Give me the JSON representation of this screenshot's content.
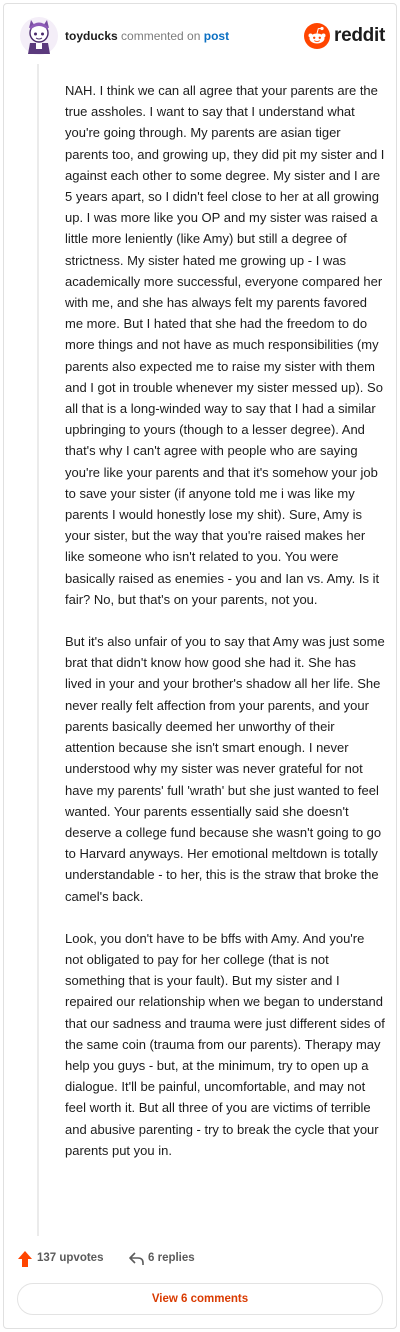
{
  "header": {
    "username": "toyducks",
    "action": "commented on",
    "target": "post",
    "brand": "reddit"
  },
  "icons": {
    "avatar": "avatar-icon",
    "logo": "reddit-logo-icon",
    "upvote": "upvote-arrow-icon",
    "reply": "reply-arrow-icon"
  },
  "colors": {
    "upvote": "#ff4500",
    "link": "#0a6fc2",
    "view_button_text": "#d93a00"
  },
  "comment": {
    "paragraphs": [
      "NAH. I think we can all agree that your parents are the true assholes. I want to say that I understand what you're going through. My parents are asian tiger parents too, and growing up, they did pit my sister and I against each other to some degree. My sister and I are 5 years apart, so I didn't feel close to her at all growing up. I was more like you OP and my sister was raised a little more leniently (like Amy) but still a degree of strictness. My sister hated me growing up - I was academically more successful, everyone compared her with me, and she has always felt my parents favored me more. But I hated that she had the freedom to do more things and not have as much responsibilities (my parents also expected me to raise my sister with them and I got in trouble whenever my sister messed up). So all that is a long-winded way to say that I had a similar upbringing to yours (though to a lesser degree). And that's why I can't agree with people who are saying you're like your parents and that it's somehow your job to save your sister (if anyone told me i was like my parents I would honestly lose my shit). Sure, Amy is your sister, but the way that you're raised makes her like someone who isn't related to you. You were basically raised as enemies - you and Ian vs. Amy. Is it fair? No, but that's on your parents, not you.",
      "But it's also unfair of you to say that Amy was just some brat that didn't know how good she had it. She has lived in your and your brother's shadow all her life. She never really felt affection from your parents, and your parents basically deemed her unworthy of their attention because she isn't smart enough. I never understood why my sister was never grateful for not have my parents' full 'wrath' but she just wanted to feel wanted. Your parents essentially said she doesn't deserve a college fund because she wasn't going to go to Harvard anyways. Her emotional meltdown is totally understandable - to her, this is the straw that broke the camel's back.",
      "Look, you don't have to be bffs with Amy. And you're not obligated to pay for her college (that is not something that is your fault). But my sister and I repaired our relationship when we began to understand that our sadness and trauma were just different sides of the same coin (trauma from our parents). Therapy may help you guys - but, at the minimum, try to open up a dialogue. It'll be painful, uncomfortable, and may not feel worth it. But all three of you are victims of terrible and abusive parenting - try to break the cycle that your parents put you in."
    ]
  },
  "footer": {
    "upvotes": "137 upvotes",
    "replies": "6 replies",
    "view_button": "View 6 comments"
  }
}
